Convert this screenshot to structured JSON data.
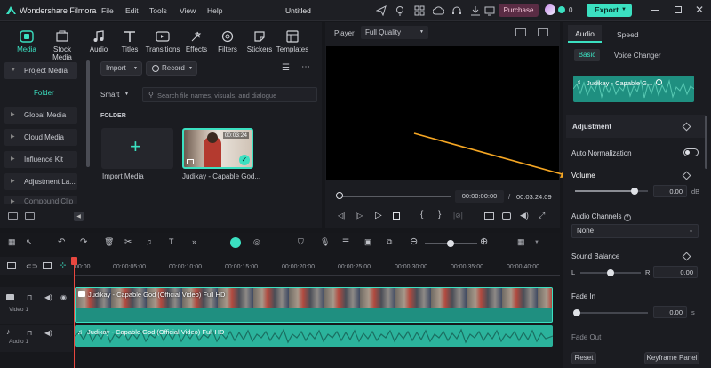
{
  "app": {
    "name": "Wondershare Filmora",
    "project": "Untitled",
    "purchase": "Purchase",
    "export": "Export",
    "credits": "0"
  },
  "menu": [
    "File",
    "Edit",
    "Tools",
    "View",
    "Help"
  ],
  "tooltabs": [
    {
      "label": "Media",
      "icon": "media-icon"
    },
    {
      "label": "Stock Media",
      "icon": "stock-media-icon"
    },
    {
      "label": "Audio",
      "icon": "music-note-icon"
    },
    {
      "label": "Titles",
      "icon": "titles-icon"
    },
    {
      "label": "Transitions",
      "icon": "transitions-icon"
    },
    {
      "label": "Effects",
      "icon": "effects-icon"
    },
    {
      "label": "Filters",
      "icon": "filters-icon"
    },
    {
      "label": "Stickers",
      "icon": "stickers-icon"
    },
    {
      "label": "Templates",
      "icon": "templates-icon"
    }
  ],
  "leftnav": {
    "project_media": "Project Media",
    "folder": "Folder",
    "items": [
      "Global Media",
      "Cloud Media",
      "Influence Kit",
      "Adjustment La...",
      "Compound Clip"
    ]
  },
  "media": {
    "import": "Import",
    "record": "Record",
    "sort": "Smart",
    "search_placeholder": "Search file names, visuals, and dialogue",
    "folder_label": "FOLDER",
    "import_media": "Import Media",
    "clip_name": "Judikay - Capable God...",
    "clip_duration": "00:03:24"
  },
  "player": {
    "label": "Player",
    "quality": "Full Quality",
    "current": "00:00:00:00",
    "separator": "/",
    "total": "00:03:24:09"
  },
  "right": {
    "tabs": [
      "Audio",
      "Speed"
    ],
    "subtabs": [
      "Basic",
      "Voice Changer"
    ],
    "clip_title": "Judikay - Capable G...",
    "adjustment": "Adjustment",
    "auto_normalization": "Auto Normalization",
    "volume": "Volume",
    "volume_value": "0.00",
    "volume_unit": "dB",
    "audio_channels": "Audio Channels",
    "channels_value": "None",
    "sound_balance": "Sound Balance",
    "balance_l": "L",
    "balance_r": "R",
    "balance_value": "0.00",
    "fade_in": "Fade In",
    "fade_in_value": "0.00",
    "fade_in_unit": "s",
    "fade_out": "Fade Out",
    "reset": "Reset",
    "keyframe_panel": "Keyframe Panel"
  },
  "timeline": {
    "ruler": [
      "00:00",
      "00:00:05:00",
      "00:00:10:00",
      "00:00:15:00",
      "00:00:20:00",
      "00:00:25:00",
      "00:00:30:00",
      "00:00:35:00",
      "00:00:40:00"
    ],
    "video_track": "Video 1",
    "audio_track": "Audio 1",
    "video_clip": "Judikay - Capable God (Official Video) Full HD",
    "audio_clip": "Judikay - Capable God (Official Video) Full HD"
  },
  "colors": {
    "accent": "#3be0c1",
    "clip": "#1f8f80",
    "audio": "#2bb39c",
    "playhead": "#e8473f",
    "annotation": "#f5a623"
  }
}
